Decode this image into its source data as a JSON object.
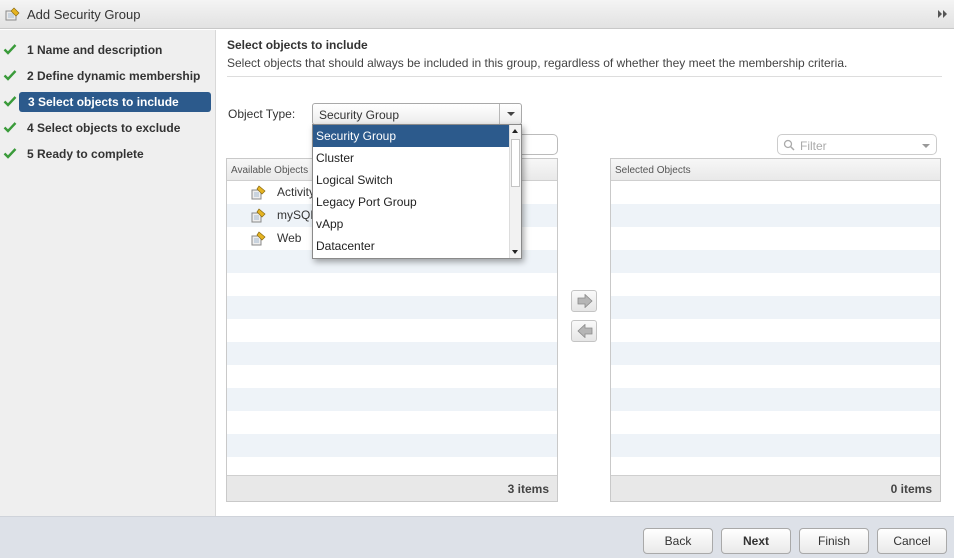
{
  "window": {
    "title": "Add Security Group",
    "expand_icon": "double-chevron-right-icon"
  },
  "steps": [
    {
      "label": "1  Name and description",
      "done": true
    },
    {
      "label": "2  Define dynamic membership",
      "done": true
    },
    {
      "label": "3  Select objects to include",
      "done": true,
      "active": true
    },
    {
      "label": "4  Select objects to exclude",
      "done": true
    },
    {
      "label": "5  Ready to complete",
      "done": true
    }
  ],
  "main": {
    "heading": "Select objects to include",
    "subheading": "Select objects that should always be included in this group, regardless of whether they meet the membership criteria.",
    "object_type_label": "Object Type:",
    "object_type_value": "Security Group"
  },
  "dropdown": {
    "options": [
      "Security Group",
      "Cluster",
      "Logical Switch",
      "Legacy Port Group",
      "vApp",
      "Datacenter"
    ],
    "selected": "Security Group"
  },
  "available": {
    "header": "Available Objects",
    "items": [
      "Activity",
      "mySQL",
      "Web"
    ],
    "count": "3 items"
  },
  "selected": {
    "header": "Selected Objects",
    "filter_placeholder": "Filter",
    "count": "0 items"
  },
  "buttons": {
    "back": "Back",
    "next": "Next",
    "finish": "Finish",
    "cancel": "Cancel"
  },
  "colors": {
    "accent": "#2c5a8c",
    "check": "#3a9b3a",
    "stripe": "#eef3f8"
  }
}
